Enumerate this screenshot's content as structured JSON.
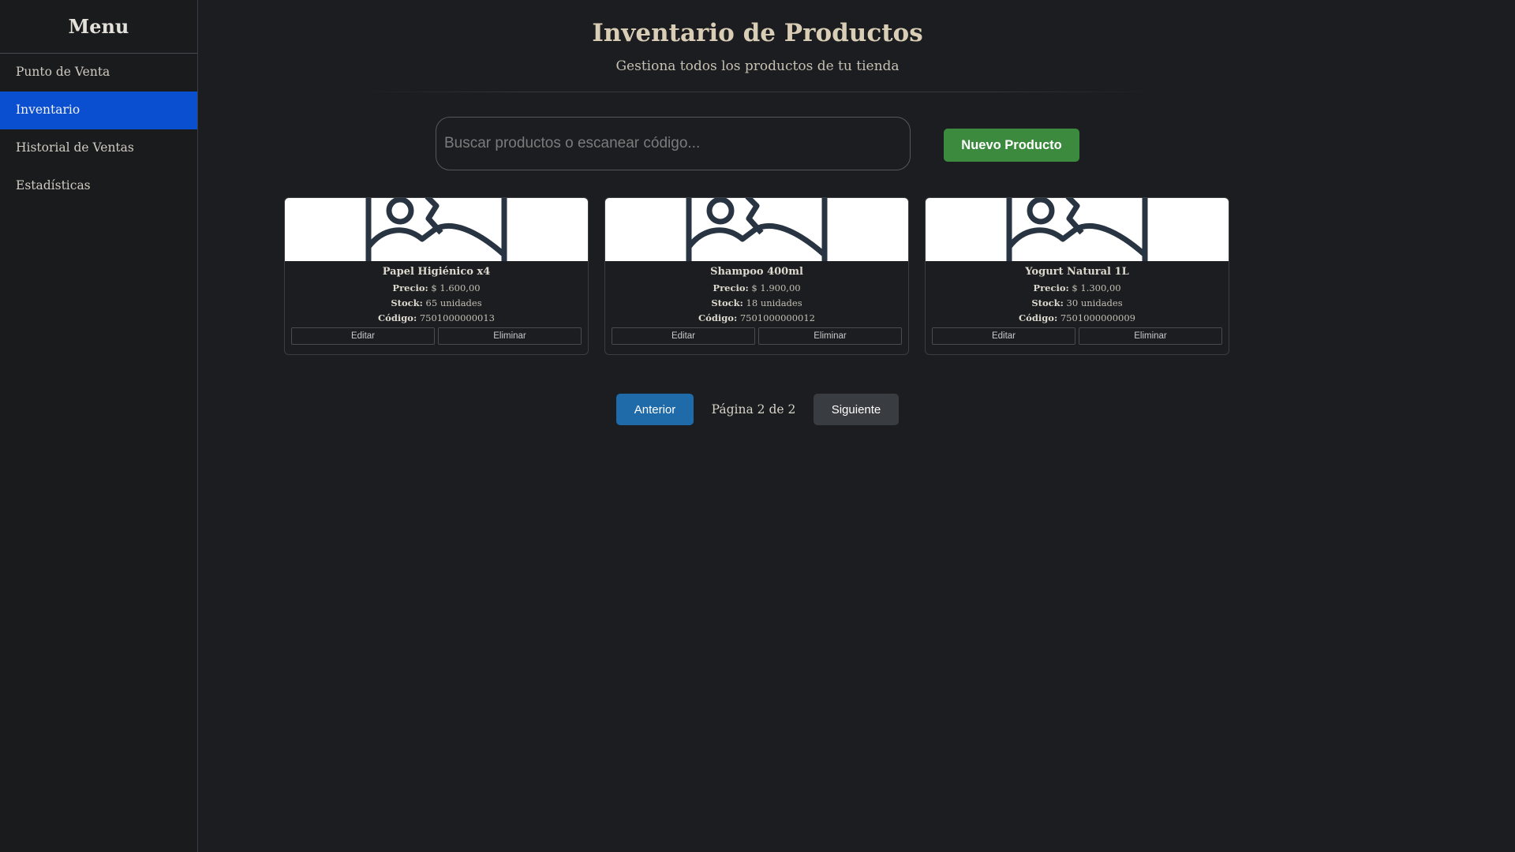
{
  "sidebar": {
    "title": "Menu",
    "items": [
      {
        "label": "Punto de Venta",
        "active": false
      },
      {
        "label": "Inventario",
        "active": true
      },
      {
        "label": "Historial de Ventas",
        "active": false
      },
      {
        "label": "Estadísticas",
        "active": false
      }
    ]
  },
  "header": {
    "title": "Inventario de Productos",
    "subtitle": "Gestiona todos los productos de tu tienda"
  },
  "search": {
    "placeholder": "Buscar productos o escanear código...",
    "value": ""
  },
  "toolbar": {
    "new_product_label": "Nuevo Producto"
  },
  "labels": {
    "price": "Precio:",
    "stock": "Stock:",
    "code": "Código:",
    "edit": "Editar",
    "delete": "Eliminar"
  },
  "products": [
    {
      "name": "Papel Higiénico x4",
      "price": "$ 1.600,00",
      "stock": "65 unidades",
      "code": "7501000000013",
      "image_icon": "image-placeholder-icon"
    },
    {
      "name": "Shampoo 400ml",
      "price": "$ 1.900,00",
      "stock": "18 unidades",
      "code": "7501000000012",
      "image_icon": "image-placeholder-icon"
    },
    {
      "name": "Yogurt Natural 1L",
      "price": "$ 1.300,00",
      "stock": "30 unidades",
      "code": "7501000000009",
      "image_icon": "image-placeholder-icon"
    }
  ],
  "pagination": {
    "prev_label": "Anterior",
    "info": "Página 2 de 2",
    "next_label": "Siguiente",
    "current_page": 2,
    "total_pages": 2
  },
  "colors": {
    "background": "#1b1d20",
    "active_nav": "#0a4fcf",
    "new_button": "#3b8a3e",
    "prev_button": "#1f6aa8",
    "next_button": "#393c40"
  }
}
